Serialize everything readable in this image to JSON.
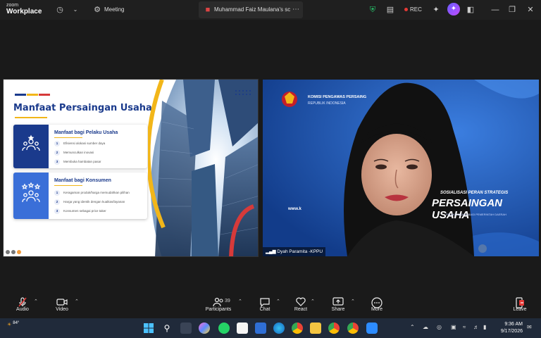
{
  "app": {
    "brand_small": "zoom",
    "brand_main": "Workplace"
  },
  "titlebar": {
    "meeting_label": "Meeting",
    "tab_title": "Muhammad Faiz Maulana's screen",
    "rec_label": "REC"
  },
  "share": {
    "slide_title": "Manfaat Persaingan Usaha",
    "card1": {
      "title": "Manfaat bagi Pelaku Usaha",
      "items": [
        {
          "num": "1",
          "text": "Efisiensi alokasi sumber daya"
        },
        {
          "num": "2",
          "text": "Memunculkan inovasi"
        },
        {
          "num": "3",
          "text": "Membuka hambatan pasar"
        }
      ]
    },
    "card2": {
      "title": "Manfaat bagi Konsumen",
      "items": [
        {
          "num": "1",
          "text": "Keragaman produk/harga memudahkan pilihan"
        },
        {
          "num": "2",
          "text": "Harga yang identik dengan kualitas/layanan"
        },
        {
          "num": "3",
          "text": "Konsumen sebagai price taker"
        }
      ]
    }
  },
  "video": {
    "org_line1": "KOMISI PENGAWAS PERSAING",
    "org_line2": "REPUBLIK INDONESIA",
    "sos_line1": "SOSIALISASI PERAN STRATEGIS",
    "sos_line2": "PERSAINGAN USAHA",
    "sos_line3": "PELAKU USAHA BAGI PEMERINTAH DAERAH",
    "url_text": "www.k",
    "participant_name": "Dyah Paramita -KPPU"
  },
  "toolbar": {
    "audio": "Audio",
    "video": "Video",
    "participants": "Participants",
    "participants_count": "39",
    "chat": "Chat",
    "react": "React",
    "share": "Share",
    "more": "More",
    "leave": "Leave"
  },
  "taskbar": {
    "weather": "84°",
    "time": "9:36 AM",
    "date": "9/17/2026"
  },
  "colors": {
    "accent_blue": "#1a3a8c",
    "accent_gold": "#f2b619",
    "rec_red": "#e53935",
    "leave_red": "#e53935"
  }
}
